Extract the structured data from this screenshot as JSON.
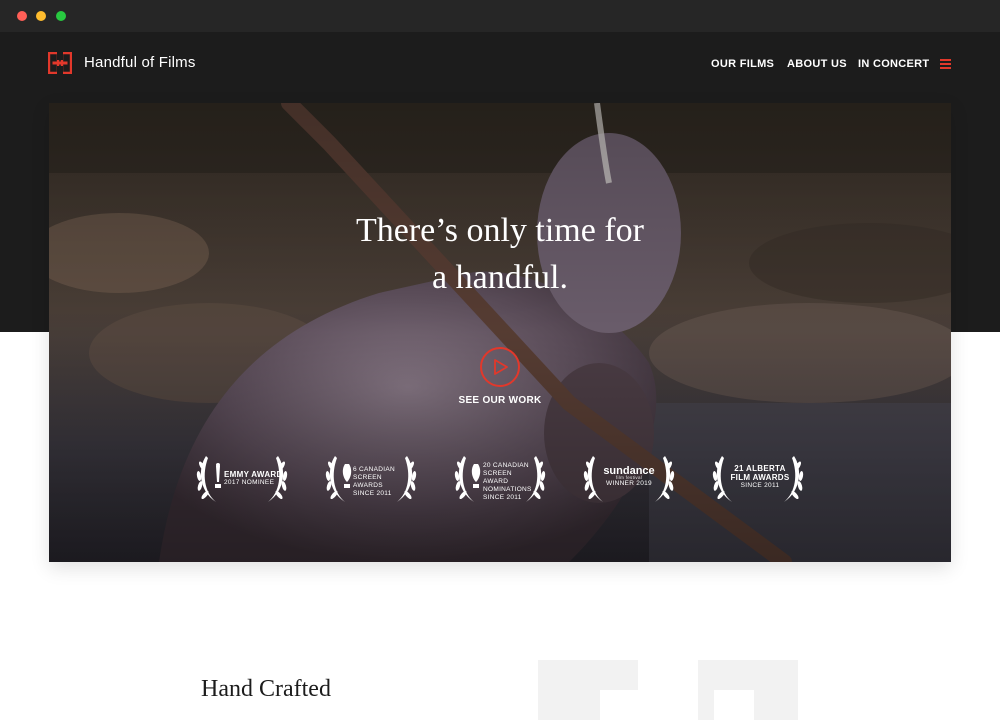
{
  "window": {
    "buttons": [
      "close",
      "minimize",
      "zoom"
    ]
  },
  "header": {
    "brand": "Handful of Films",
    "logo_icon": "handful-logo-icon",
    "nav": [
      {
        "label": "OUR FILMS"
      },
      {
        "label": "ABOUT US"
      },
      {
        "label": "IN CONCERT"
      }
    ],
    "menu_icon": "hamburger-menu-icon"
  },
  "hero": {
    "headline_line1": "There’s only time for",
    "headline_line2": "a handful.",
    "cta_label": "SEE OUR WORK",
    "cta_icon": "play-icon"
  },
  "awards": [
    {
      "title": "EMMY AWARD",
      "subtitle": "2017 NOMINEE",
      "icon": "emmy-statuette-icon"
    },
    {
      "title": "6 CANADIAN SCREEN AWARDS",
      "subtitle": "SINCE 2011",
      "icon": "screen-award-statuette-icon"
    },
    {
      "title": "20 CANADIAN SCREEN AWARD NOMINATIONS",
      "subtitle": "SINCE 2011",
      "icon": "screen-award-statuette-icon"
    },
    {
      "title": "sundance",
      "subtitle": "WINNER 2019",
      "tagline": "film festival"
    },
    {
      "title": "21 ALBERTA FILM AWARDS",
      "subtitle": "SINCE 2011"
    }
  ],
  "section": {
    "title": "Hand Crafted"
  },
  "colors": {
    "accent": "#e2382b",
    "dark": "#1c1c1c",
    "chrome": "#262626"
  }
}
